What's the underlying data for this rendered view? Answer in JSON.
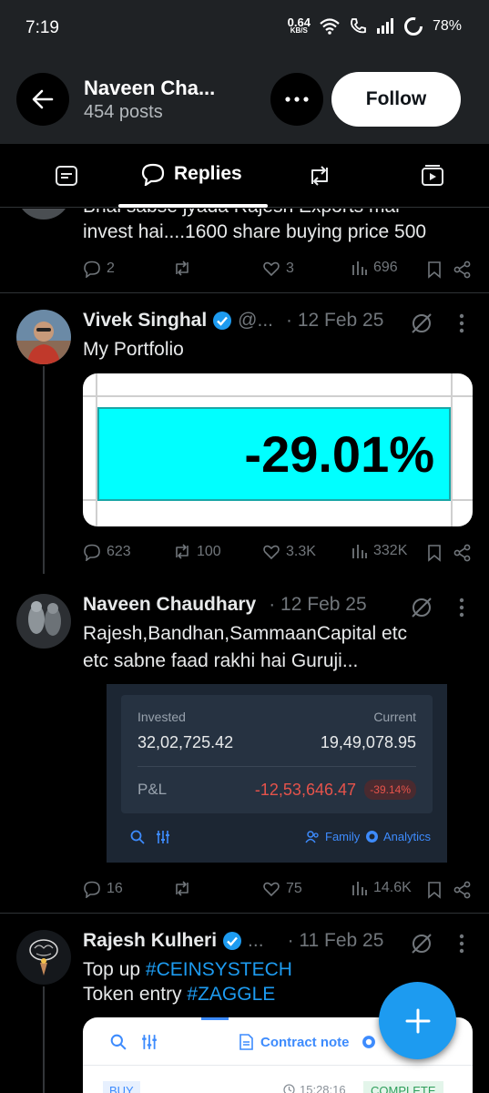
{
  "status_bar": {
    "time": "7:19",
    "net_speed": "0.64",
    "net_unit": "KB/S",
    "battery": "78%"
  },
  "header": {
    "name": "Naveen Cha...",
    "posts": "454 posts",
    "follow_label": "Follow"
  },
  "tabs": {
    "replies_label": "Replies"
  },
  "tweets": [
    {
      "text_line1": "Bhai sabse jyada Rajesh Exports mai",
      "text_line2": "invest hai....1600 share buying price 500",
      "replies": "2",
      "reposts": "",
      "likes": "3",
      "views": "696"
    },
    {
      "name": "Vivek Singhal",
      "handle": "@...",
      "date": "· 12 Feb 25",
      "text_line1": "My Portfolio",
      "image": {
        "value": "-29.01%"
      },
      "replies": "623",
      "reposts": "100",
      "likes": "3.3K",
      "views": "332K"
    },
    {
      "name": "Naveen Chaudhary",
      "handle": "",
      "date": "· 12 Feb 25",
      "text_line1": "Rajesh,Bandhan,SammaanCapital etc",
      "text_line2": "etc sabne faad rakhi hai Guruji...",
      "image": {
        "invested_label": "Invested",
        "invested_value": "32,02,725.42",
        "current_label": "Current",
        "current_value": "19,49,078.95",
        "pl_label": "P&L",
        "pl_value": "-12,53,646.47",
        "pl_pct": "-39.14%",
        "family_label": "Family",
        "analytics_label": "Analytics"
      },
      "replies": "16",
      "reposts": "",
      "likes": "75",
      "views": "14.6K"
    },
    {
      "name": "Rajesh Kulheri",
      "handle": "...",
      "date": "· 11 Feb 25",
      "text_line1": "Top up ",
      "hashtag1": "#CEINSYSTECH",
      "text_line2": "Token entry ",
      "hashtag2": "#ZAGGLE",
      "image": {
        "contract_note_label": "Contract note",
        "buy_label": "BUY",
        "time": "15:28:16",
        "status": "COMPLETE"
      }
    }
  ],
  "colors": {
    "accent": "#1d9bf0",
    "background": "#000000",
    "muted": "#71767b",
    "loss": "#e5534b",
    "cyan": "#00ffff"
  }
}
